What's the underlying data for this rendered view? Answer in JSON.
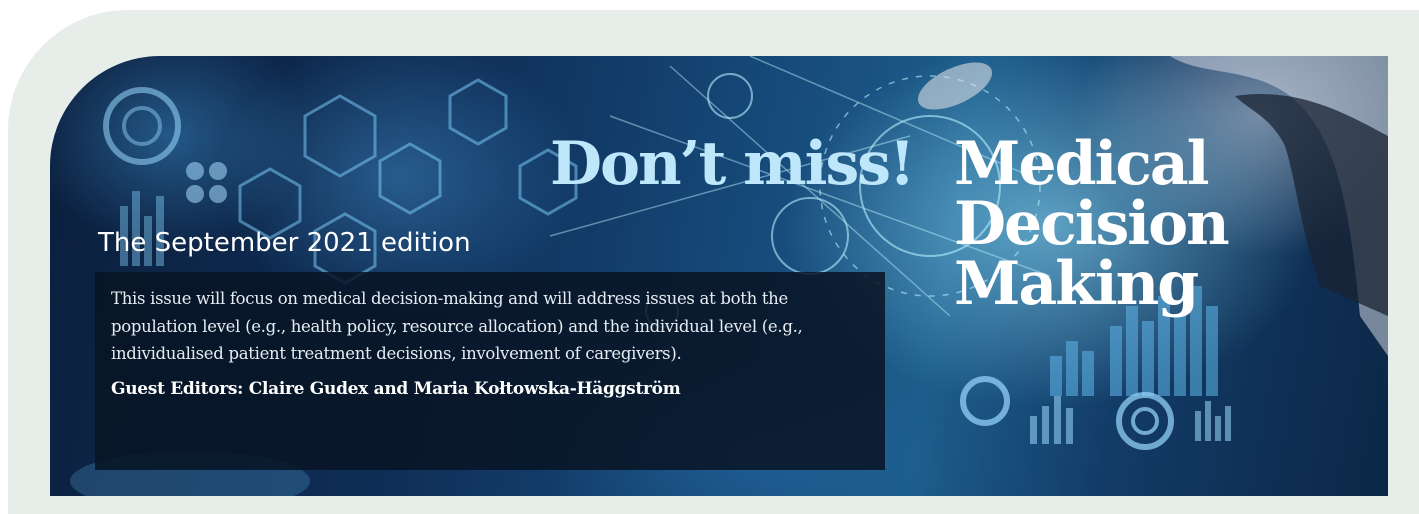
{
  "banner": {
    "dont_miss": "Don’t miss!",
    "journal_title_lines": [
      "Medical",
      "Decision",
      "Making"
    ],
    "edition": "The September 2021 edition",
    "description": "This issue will focus on medical decision-making and will address issues at both the population level (e.g., health policy, resource allocation) and the individual level (e.g., individualised patient treatment decisions, involvement of caregivers).",
    "guest_editors": "Guest Editors: Claire Gudex and Maria Kołtowska-Häggström",
    "image_subject": "digital-healthcare-interface-photo"
  },
  "colors": {
    "frame_background": "#e7eeea",
    "dont_miss_text": "#bfe7fb",
    "title_text": "#ffffff",
    "textbox_background": "#081424"
  }
}
